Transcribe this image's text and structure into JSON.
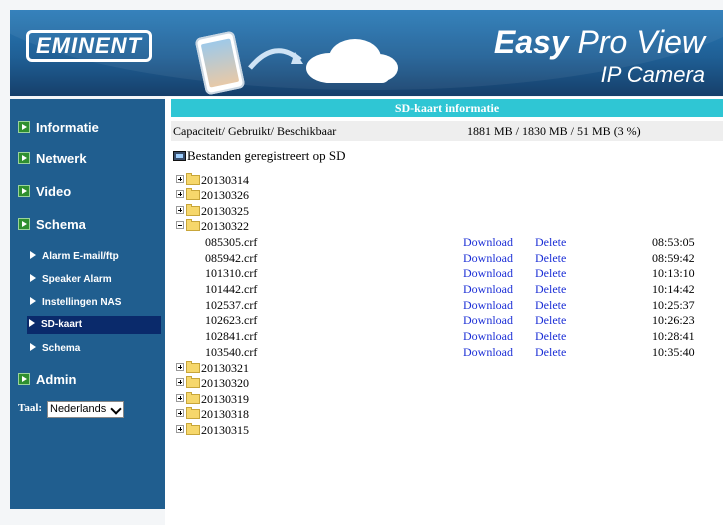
{
  "header": {
    "logo_text": "EMINENT",
    "brand_bold": "Easy",
    "brand_rest": "Pro View",
    "brand_sub": "IP Camera"
  },
  "sidebar": {
    "main_items": [
      {
        "label": "Informatie"
      },
      {
        "label": "Netwerk"
      },
      {
        "label": "Video"
      },
      {
        "label": "Schema"
      }
    ],
    "sub_items": [
      {
        "label": "Alarm E-mail/ftp"
      },
      {
        "label": "Speaker Alarm"
      },
      {
        "label": "Instellingen NAS"
      },
      {
        "label": "SD-kaart",
        "active": true
      },
      {
        "label": "Schema"
      }
    ],
    "admin_label": "Admin",
    "language_label": "Taal:",
    "language_value": "Nederlands"
  },
  "main": {
    "title": "SD-kaart informatie",
    "capacity_label": "Capaciteit/ Gebruikt/ Beschikbaar",
    "capacity_value": "1881 MB / 1830 MB / 51 MB (3 %)",
    "files_header": "Bestanden geregistreert op SD",
    "folders_before": [
      "20130314",
      "20130326",
      "20130325"
    ],
    "open_folder": "20130322",
    "files": [
      {
        "name": "085305.crf",
        "download": "Download",
        "delete": "Delete",
        "time": "08:53:05"
      },
      {
        "name": "085942.crf",
        "download": "Download",
        "delete": "Delete",
        "time": "08:59:42"
      },
      {
        "name": "101310.crf",
        "download": "Download",
        "delete": "Delete",
        "time": "10:13:10"
      },
      {
        "name": "101442.crf",
        "download": "Download",
        "delete": "Delete",
        "time": "10:14:42"
      },
      {
        "name": "102537.crf",
        "download": "Download",
        "delete": "Delete",
        "time": "10:25:37"
      },
      {
        "name": "102623.crf",
        "download": "Download",
        "delete": "Delete",
        "time": "10:26:23"
      },
      {
        "name": "102841.crf",
        "download": "Download",
        "delete": "Delete",
        "time": "10:28:41"
      },
      {
        "name": "103540.crf",
        "download": "Download",
        "delete": "Delete",
        "time": "10:35:40"
      }
    ],
    "folders_after": [
      "20130321",
      "20130320",
      "20130319",
      "20130318",
      "20130315"
    ]
  }
}
